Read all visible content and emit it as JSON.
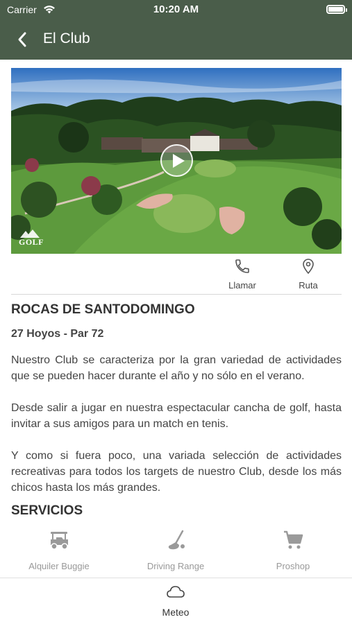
{
  "status_bar": {
    "carrier": "Carrier",
    "time": "10:20 AM"
  },
  "nav": {
    "title": "El Club",
    "back_icon": "chevron-left-icon"
  },
  "hero": {
    "logo_text": "GOLF",
    "play_icon": "play-icon"
  },
  "actions": [
    {
      "label": "Llamar",
      "icon": "phone-icon"
    },
    {
      "label": "Ruta",
      "icon": "location-pin-icon"
    }
  ],
  "club": {
    "name": "ROCAS DE SANTODOMINGO",
    "holes": "27 Hoyos - Par 72",
    "description": [
      "Nuestro Club se caracteriza por la gran variedad de actividades que se pueden hacer durante el año y no sólo en el verano.",
      "Desde salir a jugar en nuestra espectacular cancha de golf, hasta invitar a sus amigos para un match en tenis.",
      "Y como si fuera poco, una variada selección de actividades recreativas para todos los targets de nuestro Club, desde los más chicos hasta los más grandes."
    ]
  },
  "services": {
    "title": "SERVICIOS",
    "items": [
      {
        "label": "Alquiler Buggie",
        "icon": "golf-cart-icon"
      },
      {
        "label": "Driving Range",
        "icon": "golf-club-icon"
      },
      {
        "label": "Proshop",
        "icon": "shopping-cart-icon"
      }
    ]
  },
  "tab_bar": {
    "items": [
      {
        "label": "Meteo",
        "icon": "cloud-icon"
      }
    ]
  },
  "colors": {
    "header": "#4a5d4a",
    "service_icon": "#9a9a9a"
  }
}
